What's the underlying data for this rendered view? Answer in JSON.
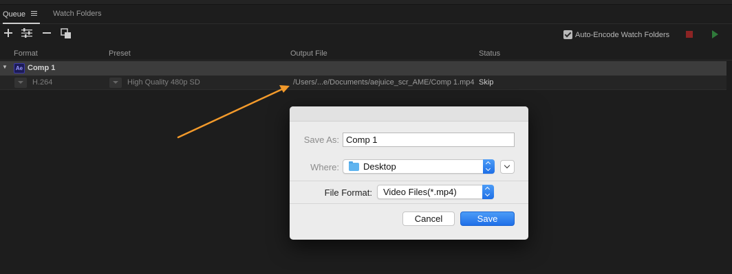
{
  "tabs": {
    "queue": "Queue",
    "watch_folders": "Watch Folders"
  },
  "toolbar": {
    "auto_encode_label": "Auto-Encode Watch Folders",
    "auto_encode_checked": true,
    "icons": [
      "add-icon",
      "settings-sliders-icon",
      "remove-icon",
      "duplicate-icon",
      "stop-icon",
      "play-icon"
    ]
  },
  "columns": {
    "format": "Format",
    "preset": "Preset",
    "output": "Output File",
    "status": "Status"
  },
  "queue": {
    "group": {
      "app_badge": "Ae",
      "name": "Comp 1"
    },
    "item": {
      "format": "H.264",
      "preset": "High Quality 480p SD",
      "output": "/Users/...e/Documents/aejuice_scr_AME/Comp 1.mp4",
      "status": "Skip"
    }
  },
  "dialog": {
    "save_as_label": "Save As:",
    "save_as_value": "Comp 1",
    "where_label": "Where:",
    "where_value": "Desktop",
    "file_format_label": "File Format:",
    "file_format_value": "Video Files(*.mp4)",
    "cancel": "Cancel",
    "save": "Save"
  },
  "colors": {
    "arrow": "#f39a2b",
    "accent": "#1f6fe8",
    "background": "#1d1d1d"
  }
}
